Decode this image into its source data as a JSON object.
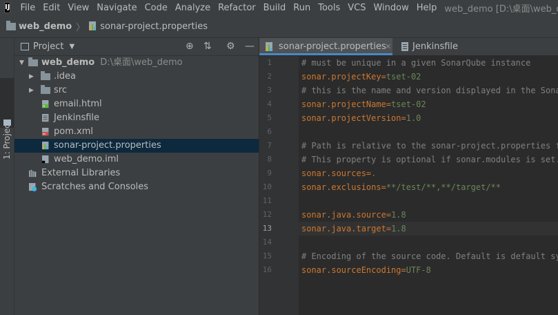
{
  "app": {
    "logo_text": "IJ"
  },
  "menu": [
    "File",
    "Edit",
    "View",
    "Navigate",
    "Code",
    "Analyze",
    "Refactor",
    "Build",
    "Run",
    "Tools",
    "VCS",
    "Window",
    "Help"
  ],
  "window_title": "web_demo [D:\\桌面\\web_demo]",
  "breadcrumb": {
    "project": "web_demo",
    "separator": "〉",
    "file": "sonar-project.properties"
  },
  "sidestrip": {
    "label": "1: Project"
  },
  "project_panel": {
    "title": "Project",
    "tree": [
      {
        "label": "web_demo",
        "path": "D:\\桌面\\web_demo"
      },
      {
        "label": ".idea"
      },
      {
        "label": "src"
      },
      {
        "label": "email.html"
      },
      {
        "label": "Jenkinsfile"
      },
      {
        "label": "pom.xml"
      },
      {
        "label": "sonar-project.properties"
      },
      {
        "label": "web_demo.iml"
      },
      {
        "label": "External Libraries"
      },
      {
        "label": "Scratches and Consoles"
      }
    ]
  },
  "editor": {
    "tabs": [
      {
        "label": "sonar-project.properties",
        "active": true
      },
      {
        "label": "Jenkinsfile",
        "active": false
      }
    ],
    "line_numbers": [
      "1",
      "2",
      "3",
      "4",
      "5",
      "6",
      "7",
      "8",
      "9",
      "10",
      "11",
      "12",
      "13",
      "14",
      "15",
      "16"
    ],
    "current_line": 13,
    "lines": [
      {
        "comment": "# must be unique in a given SonarQube instance"
      },
      {
        "key": "sonar.projectKey",
        "value": "tset-02"
      },
      {
        "comment": "# this is the name and version displayed in the SonarQ"
      },
      {
        "key": "sonar.projectName",
        "value": "tset-02"
      },
      {
        "key": "sonar.projectVersion",
        "value": "1.0"
      },
      {},
      {
        "comment": "# Path is relative to the sonar-project.properties file"
      },
      {
        "comment": "# This property is optional if sonar.modules is set."
      },
      {
        "key": "sonar.sources",
        "value": "."
      },
      {
        "key": "sonar.exclusions",
        "value": "**/test/**,**/target/**"
      },
      {},
      {
        "key": "sonar.java.source",
        "value": "1.8"
      },
      {
        "key": "sonar.java.target",
        "value": "1.8"
      },
      {},
      {
        "comment": "# Encoding of the source code. Default is default syst"
      },
      {
        "key": "sonar.sourceEncoding",
        "value": "UTF-8"
      }
    ]
  },
  "colors": {
    "background": "#2b2b2b",
    "panel": "#3c3f41",
    "selection": "#0d293e",
    "accent": "#4a88c7"
  }
}
